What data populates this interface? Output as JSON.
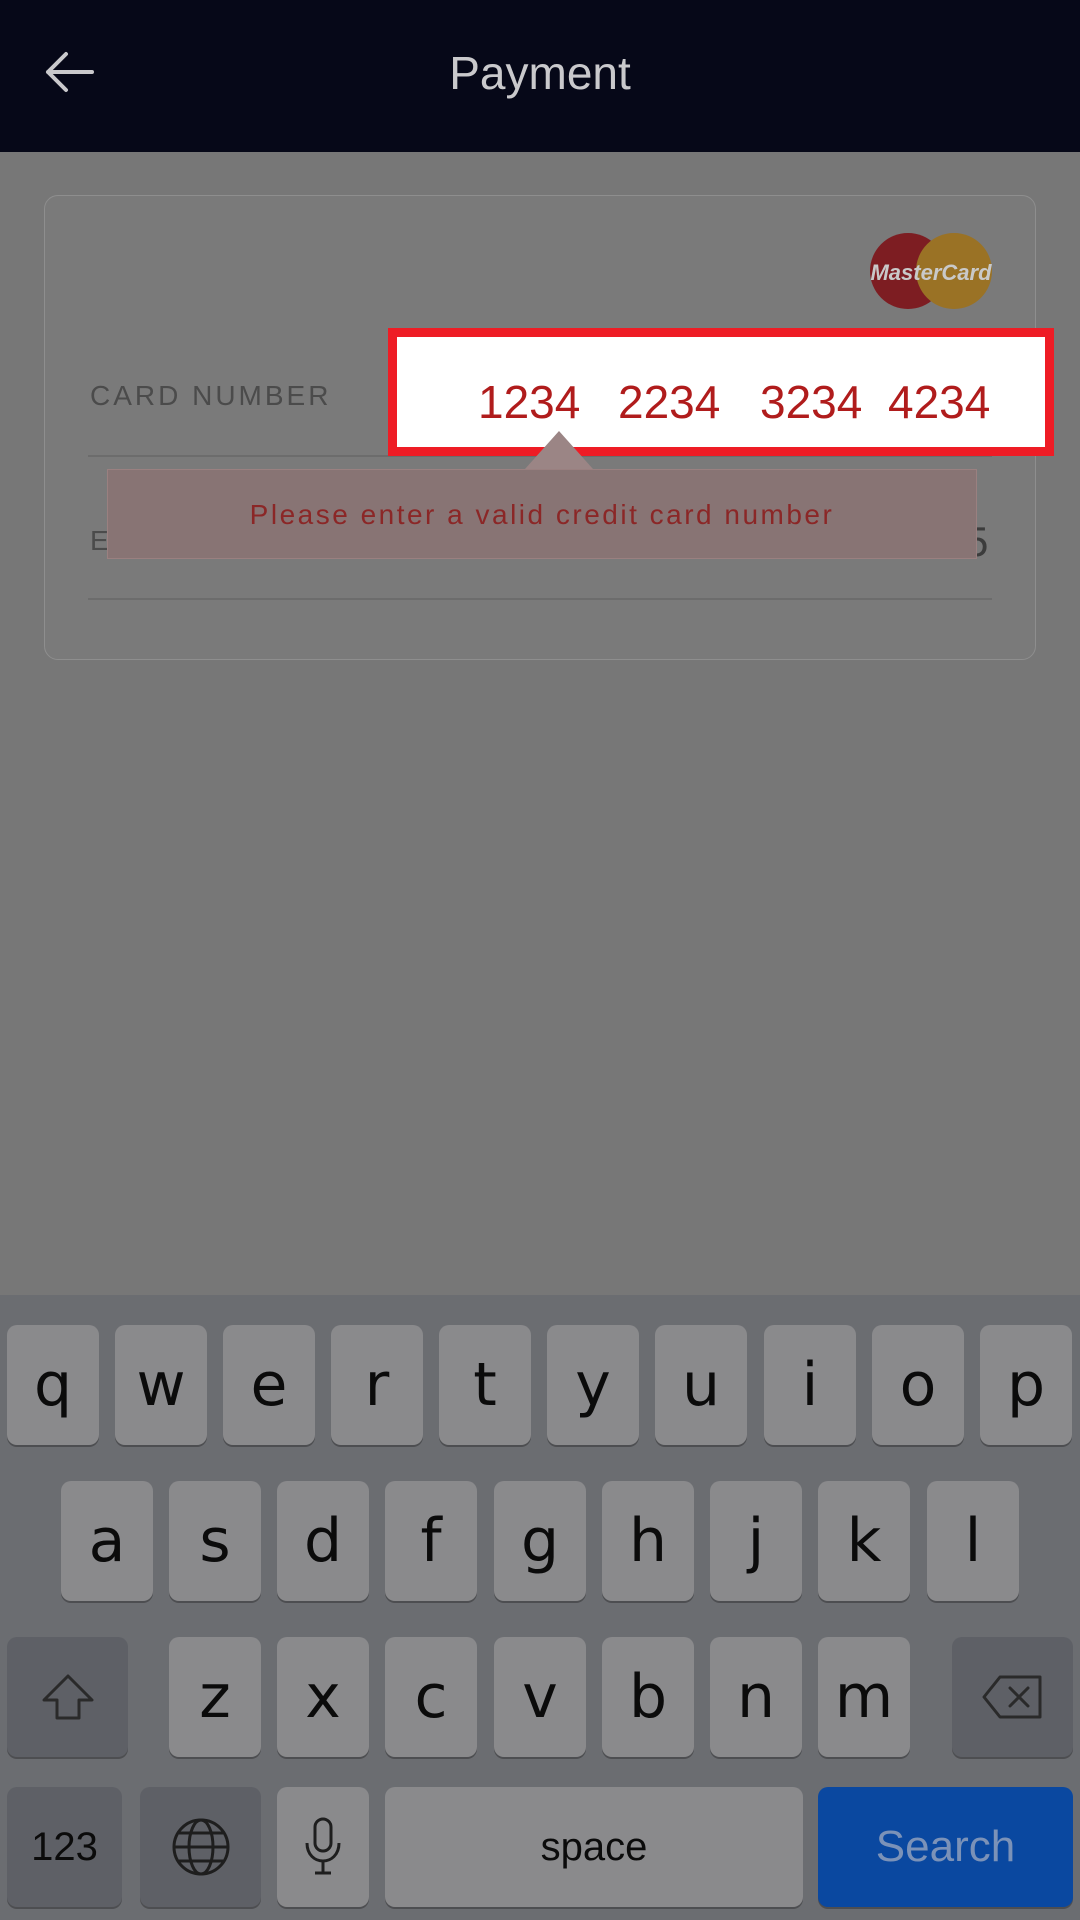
{
  "header": {
    "title": "Payment",
    "back_icon": "arrow-left-icon"
  },
  "card": {
    "brand": "MasterCard",
    "card_number_label": "CARD NUMBER",
    "card_number_groups": [
      "1234",
      "2234",
      "3234",
      "4234"
    ],
    "expiry_label_partial": "E",
    "expiry_value_partial": "5",
    "error_message": "Please enter a valid credit card number"
  },
  "keyboard": {
    "row1": [
      "q",
      "w",
      "e",
      "r",
      "t",
      "y",
      "u",
      "i",
      "o",
      "p"
    ],
    "row2": [
      "a",
      "s",
      "d",
      "f",
      "g",
      "h",
      "j",
      "k",
      "l"
    ],
    "row3": [
      "z",
      "x",
      "c",
      "v",
      "b",
      "n",
      "m"
    ],
    "numbers_label": "123",
    "space_label": "space",
    "search_label": "Search"
  },
  "colors": {
    "highlight_border": "#ee1c25",
    "search_key": "#0a48a0",
    "error_text": "#8b2727"
  }
}
